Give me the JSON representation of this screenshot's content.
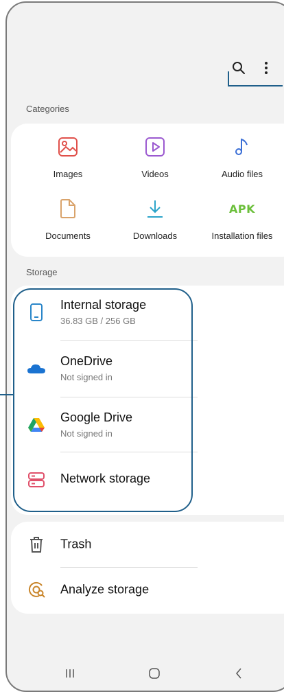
{
  "header": {
    "search_icon": "search-icon",
    "more_icon": "more-options-icon"
  },
  "sections": {
    "categories_label": "Categories",
    "storage_label": "Storage"
  },
  "categories": [
    {
      "label": "Images",
      "icon": "image-icon",
      "color": "#e0504a"
    },
    {
      "label": "Videos",
      "icon": "video-icon",
      "color": "#9b59d0"
    },
    {
      "label": "Audio files",
      "icon": "music-note-icon",
      "color": "#3b6fd6"
    },
    {
      "label": "Documents",
      "icon": "document-icon",
      "color": "#d9a36b"
    },
    {
      "label": "Downloads",
      "icon": "download-icon",
      "color": "#2aa3c9"
    },
    {
      "label": "Installation files",
      "icon_text": "APK",
      "color": "#6bbf3a"
    }
  ],
  "storage": [
    {
      "title": "Internal storage",
      "subtitle": "36.83 GB / 256 GB",
      "icon": "phone-icon",
      "color": "#2a86c9"
    },
    {
      "title": "OneDrive",
      "subtitle": "Not signed in",
      "icon": "onedrive-cloud-icon",
      "color": "#1a73d1"
    },
    {
      "title": "Google Drive",
      "subtitle": "Not signed in",
      "icon": "google-drive-icon",
      "color": "#1fa463"
    },
    {
      "title": "Network storage",
      "icon": "server-icon",
      "color": "#e0506a"
    }
  ],
  "tools": [
    {
      "title": "Trash",
      "icon": "trash-icon",
      "color": "#555555"
    },
    {
      "title": "Analyze storage",
      "icon": "analyze-storage-icon",
      "color": "#c9852a"
    }
  ],
  "nav": {
    "recents_icon": "recents-icon",
    "home_icon": "home-icon",
    "back_icon": "back-icon"
  },
  "accent_color": "#1f5f8a"
}
